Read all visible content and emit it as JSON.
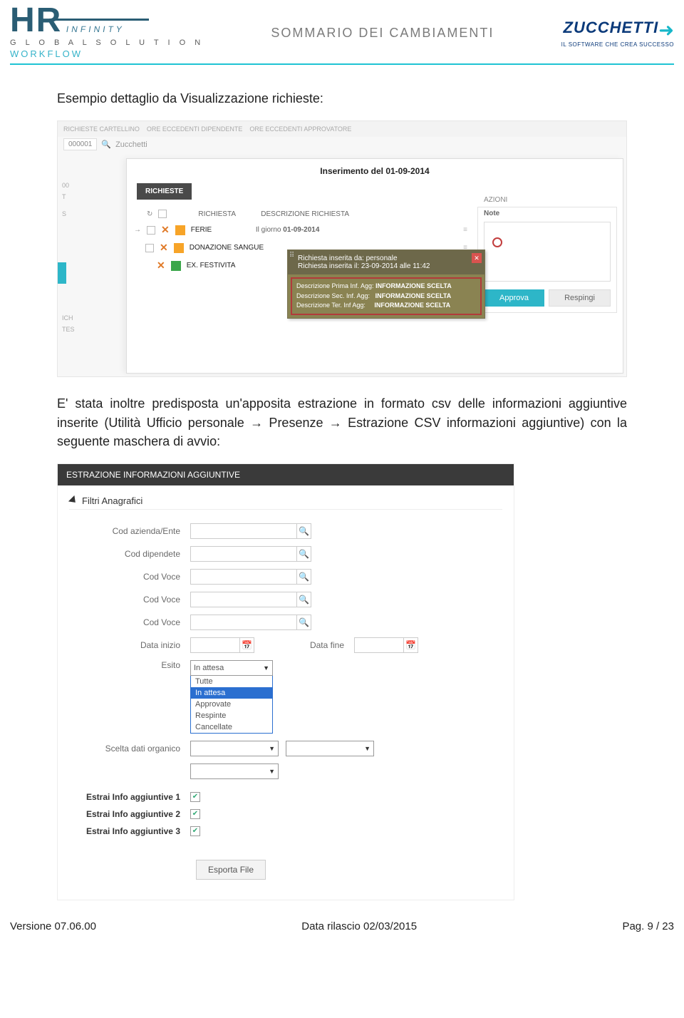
{
  "header": {
    "logo_top": "INFINITY",
    "logo_hr": "HR",
    "logo_sub1": "G L O B A L   S O L U T I O N",
    "logo_sub2": "WORKFLOW",
    "title": "SOMMARIO DEI CAMBIAMENTI",
    "right_logo": "ZUCCHETTI",
    "right_sub": "IL SOFTWARE CHE CREA SUCCESSO"
  },
  "body": {
    "intro": "Esempio dettaglio da Visualizzazione richieste:",
    "para2": "E' stata inoltre predisposta un'apposita estrazione in formato csv delle informazioni aggiuntive inserite (Utilità Ufficio personale → Presenze → Estrazione CSV informazioni aggiuntive) con la seguente maschera di avvio:"
  },
  "shot1": {
    "tabs": [
      "RICHIESTE CARTELLINO",
      "ORE ECCEDENTI DIPENDENTE",
      "ORE ECCEDENTI APPROVATORE"
    ],
    "id": "000001",
    "search_placeholder": "Zucchetti",
    "modal_title": "Inserimento del 01-09-2014",
    "richieste_tab": "RICHIESTE",
    "col_req": "RICHIESTA",
    "col_desc": "DESCRIZIONE RICHIESTA",
    "rows": [
      {
        "name": "FERIE",
        "color": "orange",
        "desc": "Il giorno 01-09-2014"
      },
      {
        "name": "DONAZIONE SANGUE",
        "color": "orange",
        "desc": ""
      },
      {
        "name": "EX. FESTIVITA",
        "color": "green",
        "desc": ""
      }
    ],
    "popup": {
      "line1": "Richiesta inserita da:  personale",
      "line2": "Richiesta inserita il:  23-09-2014 alle 11:42",
      "d1a": "Descrizione Prima Inf. Agg:",
      "d2a": "Descrizione Sec. Inf. Agg:",
      "d3a": "Descrizione Ter. Inf Agg:",
      "val": "INFORMAZIONE SCELTA"
    },
    "azioni": "AZIONI",
    "note": "Note",
    "approva": "Approva",
    "respingi": "Respingi"
  },
  "shot2": {
    "title": "ESTRAZIONE INFORMAZIONI AGGIUNTIVE",
    "section": "Filtri Anagrafici",
    "labels": {
      "azienda": "Cod azienda/Ente",
      "dipendente": "Cod dipendete",
      "voce": "Cod  Voce",
      "inizio": "Data inizio",
      "fine": "Data fine",
      "esito": "Esito",
      "scelta": "Scelta dati organico",
      "e1": "Estrai Info aggiuntive 1",
      "e2": "Estrai Info aggiuntive 2",
      "e3": "Estrai Info aggiuntive 3"
    },
    "esito_value": "In attesa",
    "esito_options": [
      "Tutte",
      "In attesa",
      "Approvate",
      "Respinte",
      "Cancellate"
    ],
    "export": "Esporta File"
  },
  "footer": {
    "ver": "Versione 07.06.00",
    "date": "Data rilascio 02/03/2015",
    "page": "Pag. 9 / 23"
  }
}
